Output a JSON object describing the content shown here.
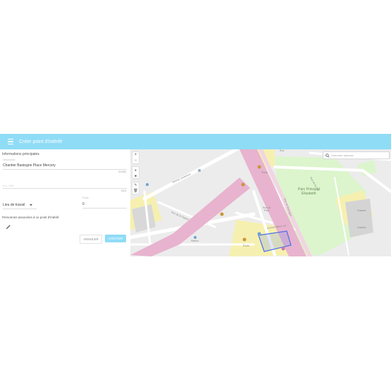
{
  "header": {
    "title": "Créer point d'intérêt"
  },
  "form": {
    "section_title": "Informations principales",
    "description": {
      "label": "Description",
      "value": "Chantier Bastogne Place Mercery",
      "counter": "31/255"
    },
    "other_field": {
      "placeholder": "N.c. 259",
      "counter": "0/15"
    },
    "type_select": {
      "value": "Lieu de travail"
    },
    "poids": {
      "label": "Poids",
      "value": "0"
    },
    "people_title": "Personnes associées à ce point d'intérêt",
    "cancel_label": "ANNULER",
    "add_label": "AJOUTER"
  },
  "map": {
    "search_placeholder": "Chercher adresse",
    "controls": {
      "zoom_in": "+",
      "zoom_out": "−",
      "draw_point": "●",
      "draw_square": "■",
      "edit": "✎",
      "delete": "🗑"
    },
    "labels": {
      "park": "Parc Principal",
      "park_sub": "Elisabeth",
      "rue_parc": "Rue du",
      "rue_parc2": "Parc",
      "avenue_albert": "Avenue Albert 1er",
      "biopark": "Gosbert",
      "biopark2": "Gosbert",
      "rue_boulevard": "Rue de la Station",
      "avenue_charleroi": "Avenue Joséphine",
      "street_top": "Rue",
      "place": "Place",
      "rue_bastogne": "Rue de Bastogne",
      "rue_cite": "Rue de la Cité",
      "ecole": "École",
      "station": "Station"
    }
  },
  "colors": {
    "header": "#8fdcf6",
    "main_road": "#e8b3ce",
    "park": "#dcf5cc",
    "zone": "#f6f0b0",
    "selection": "#4a6ee8"
  }
}
